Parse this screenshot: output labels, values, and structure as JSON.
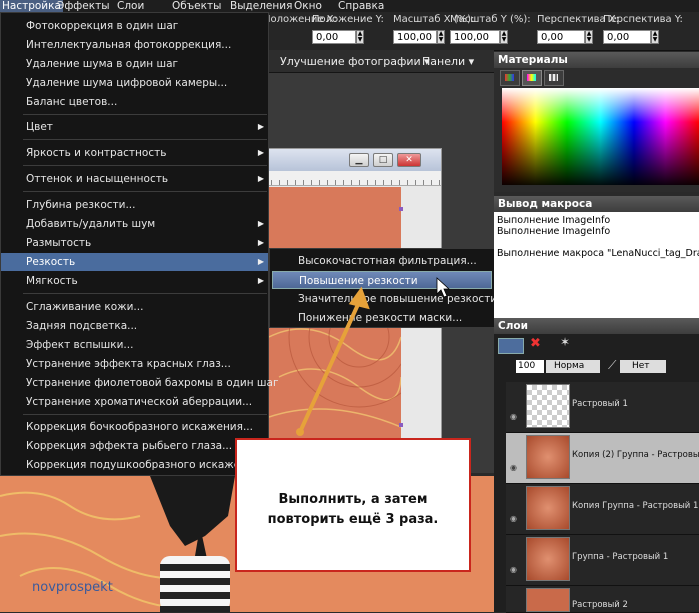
{
  "menubar": {
    "items": [
      "Настройка",
      "Эффекты",
      "Слои",
      "Объекты",
      "Выделения",
      "Окно",
      "Справка"
    ]
  },
  "toolopts": {
    "pos_x_label": "Положение X:",
    "pos_y_label": "Положение Y:",
    "pos_x_value": "0,00",
    "pos_y_value": "0,00",
    "scale_x_label": "Масштаб X (%):",
    "scale_y_label": "Масштаб Y (%):",
    "scale_x_value": "100,00",
    "scale_y_value": "100,00",
    "persp_x_label": "Перспектива X:",
    "persp_y_label": "Перспектива Y:",
    "persp_x_value": "0,00",
    "persp_y_value": "0,00"
  },
  "toolbar2": {
    "enhance_label": "Улучшение фотографии ▾",
    "panels_label": "Панели ▾"
  },
  "menu": {
    "items": [
      {
        "label": "Фотокоррекция в один шаг"
      },
      {
        "label": "Интеллектуальная фотокоррекция..."
      },
      {
        "label": "Удаление шума в один шаг"
      },
      {
        "label": "Удаление шума цифровой камеры..."
      },
      {
        "label": "Баланс цветов..."
      },
      {
        "label": "Цвет"
      },
      {
        "label": "Яркость и контрастность"
      },
      {
        "label": "Оттенок и насыщенность"
      },
      {
        "label": "Глубина резкости..."
      },
      {
        "label": "Добавить/удалить шум"
      },
      {
        "label": "Размытость"
      },
      {
        "label": "Резкость"
      },
      {
        "label": "Мягкость"
      },
      {
        "label": "Сглаживание кожи..."
      },
      {
        "label": "Задняя подсветка..."
      },
      {
        "label": "Эффект вспышки..."
      },
      {
        "label": "Устранение эффекта красных глаз..."
      },
      {
        "label": "Устранение фиолетовой бахромы в один шаг"
      },
      {
        "label": "Устранение хроматической аберрации..."
      },
      {
        "label": "Коррекция бочкообразного искажения..."
      },
      {
        "label": "Коррекция эффекта рыбьего глаза..."
      },
      {
        "label": "Коррекция подушкообразного искажения..."
      }
    ],
    "arrow": "▶"
  },
  "submenu": {
    "items": [
      "Высокочастотная фильтрация...",
      "Повышение резкости",
      "Значительное повышение резкости",
      "Понижение резкости маски..."
    ]
  },
  "materials": {
    "title": "Материалы"
  },
  "macro": {
    "title": "Вывод макроса",
    "lines": [
      "Выполнение ImageInfo",
      "Выполнение ImageInfo",
      "",
      "Выполнение макроса \"LenaNucci_tag_Drag\" зав"
    ]
  },
  "layers": {
    "title": "Слои",
    "opacity": "100",
    "blend": "Норма",
    "lock": "Нет",
    "rows": [
      "Растровый 1",
      "Копия (2) Группа - Растровый 1",
      "Копия Группа - Растровый 1",
      "Группа - Растровый 1",
      "Растровый 2"
    ]
  },
  "callout": {
    "line1": "Выполнить, а затем",
    "line2": "повторить ещё 3 раза."
  },
  "watermark": "novprospekt",
  "colors": {
    "accent": "#4a6c9e",
    "callout_border": "#c9261d",
    "arrow": "#e6a23a"
  }
}
